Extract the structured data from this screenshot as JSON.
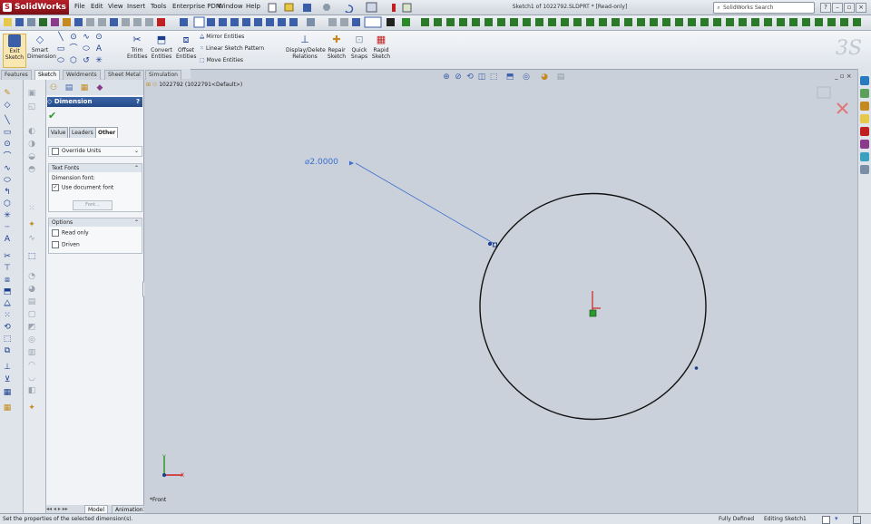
{
  "app": {
    "name": "SolidWorks",
    "title": "Sketch1 of 1022792.SLDPRT * [Read-only]"
  },
  "menu": [
    "File",
    "Edit",
    "View",
    "Insert",
    "Tools",
    "Enterprise PDM",
    "Window",
    "Help"
  ],
  "search": {
    "label": "SolidWorks Search"
  },
  "command_manager": {
    "exit_sketch": "Exit Sketch",
    "smart_dimension": "Smart Dimension",
    "trim": "Trim Entities",
    "convert": "Convert Entities",
    "offset": "Offset Entities",
    "mirror": "Mirror Entities",
    "linear_pattern": "Linear Sketch Pattern",
    "move": "Move Entities",
    "display_delete": "Display/Delete Relations",
    "repair": "Repair Sketch",
    "quick_snaps": "Quick Snaps",
    "rapid_sketch": "Rapid Sketch"
  },
  "tabs": [
    "Features",
    "Sketch",
    "Weldments",
    "Sheet Metal",
    "Simulation"
  ],
  "active_tab": "Sketch",
  "property_manager": {
    "title": "Dimension",
    "help": "?",
    "subtabs": [
      "Value",
      "Leaders",
      "Other"
    ],
    "active_subtab": "Other",
    "override_units": "Override Units",
    "text_fonts": {
      "header": "Text Fonts",
      "dimension_font": "Dimension font:",
      "use_document_font": "Use document font",
      "font_button": "Font..."
    },
    "options": {
      "header": "Options",
      "read_only": "Read only",
      "driven": "Driven"
    }
  },
  "model_tabs": [
    "Model",
    "Animation1"
  ],
  "tree": {
    "part": "1022792 (1022791<Default>)"
  },
  "graphics": {
    "dimension_text": "⌀2.0000",
    "view_label": "*Front"
  },
  "status": {
    "message": "Set the properties of the selected dimension(s).",
    "defined": "Fully Defined",
    "editing": "Editing Sketch1"
  }
}
